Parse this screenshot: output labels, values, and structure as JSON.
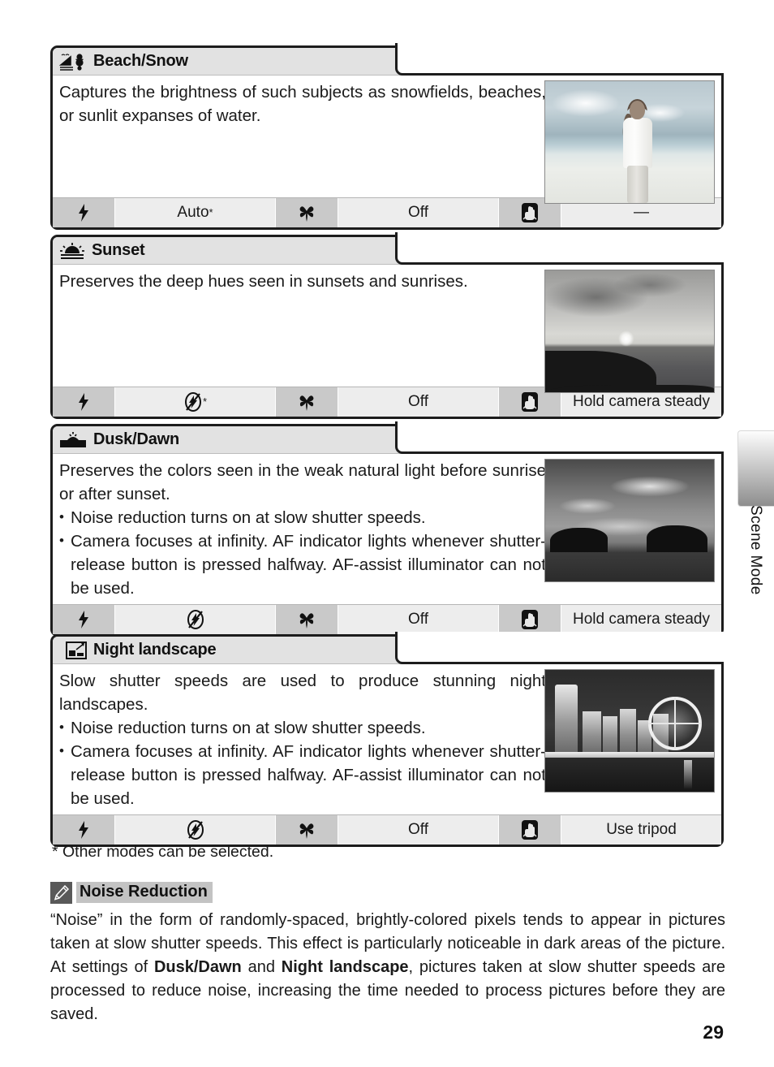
{
  "page": {
    "number": "29",
    "side_tab_label": "Scene Mode",
    "footnote": "* Other modes can be selected."
  },
  "scene_modes": [
    {
      "id": "beach-snow",
      "icon": "beach-snow-icon",
      "title": "Beach/Snow",
      "description": "Captures the brightness of such subjects as snowfields, beaches, or sunlit expanses of water.",
      "bullets": [],
      "photo": "beach-photo",
      "settings": {
        "flash_icon": "flash-icon",
        "flash_value": "Auto",
        "flash_asterisk": "*",
        "macro_icon": "macro-flower-icon",
        "macro_value": "Off",
        "steady_icon": "camera-shake-hand-icon",
        "steady_value": "—"
      }
    },
    {
      "id": "sunset",
      "icon": "sunset-icon",
      "title": "Sunset",
      "description": "Preserves the deep hues seen in sunsets and sunrises.",
      "bullets": [],
      "photo": "sunset-photo",
      "settings": {
        "flash_icon": "flash-icon",
        "flash_value_icon": "flash-off-icon",
        "flash_asterisk": "*",
        "macro_icon": "macro-flower-icon",
        "macro_value": "Off",
        "steady_icon": "camera-shake-hand-icon",
        "steady_value": "Hold camera steady"
      }
    },
    {
      "id": "dusk-dawn",
      "icon": "dusk-dawn-icon",
      "title": "Dusk/Dawn",
      "description": "Preserves the colors seen in the weak natural light before sunrise or after sunset.",
      "bullets": [
        "Noise reduction turns on at slow shutter speeds.",
        "Camera focuses at infinity.  AF indicator lights whenever shutter-release button is pressed halfway.  AF-assist illuminator can not be used."
      ],
      "photo": "dusk-photo",
      "settings": {
        "flash_icon": "flash-icon",
        "flash_value_icon": "flash-off-icon",
        "flash_asterisk": "",
        "macro_icon": "macro-flower-icon",
        "macro_value": "Off",
        "steady_icon": "camera-shake-hand-icon",
        "steady_value": "Hold camera steady"
      }
    },
    {
      "id": "night-landscape",
      "icon": "night-landscape-icon",
      "title": "Night landscape",
      "description": "Slow shutter speeds are used to produce stunning night landscapes.",
      "bullets": [
        "Noise reduction turns on at slow shutter speeds.",
        "Camera focuses at infinity.  AF indicator lights whenever shutter-release button is pressed halfway.  AF-assist illuminator can not be used."
      ],
      "photo": "night-photo",
      "settings": {
        "flash_icon": "flash-icon",
        "flash_value_icon": "flash-off-icon",
        "flash_asterisk": "",
        "macro_icon": "macro-flower-icon",
        "macro_value": "Off",
        "steady_icon": "camera-shake-hand-icon",
        "steady_value": "Use tripod"
      }
    }
  ],
  "note": {
    "icon": "pencil-note-icon",
    "title": "Noise Reduction",
    "paragraph_part1": "“Noise” in the form of randomly-spaced, brightly-colored pixels tends to appear in pictures taken at slow shutter speeds.  This effect is particularly noticeable in dark areas of the picture.  At settings of ",
    "bold1": "Dusk/Dawn",
    "paragraph_part2": " and ",
    "bold2": "Night landscape",
    "paragraph_part3": ", pictures taken at slow shutter speeds are processed to reduce noise, increasing the time needed to process pictures before they are saved."
  }
}
